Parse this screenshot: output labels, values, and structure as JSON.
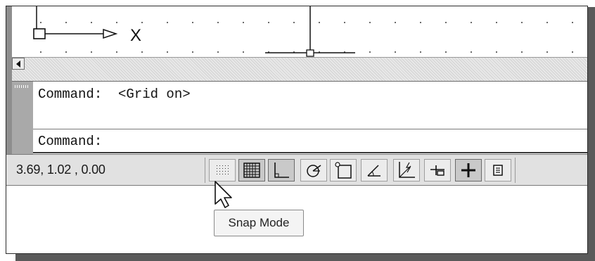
{
  "canvas": {
    "axis_label": "X"
  },
  "command_window": {
    "history_line": "Command:  <Grid on>",
    "prompt_line": "Command:"
  },
  "status_bar": {
    "coordinates": "3.69, 1.02 , 0.00",
    "toggles": [
      {
        "name": "snap-mode",
        "icon": "snap-dots-icon",
        "state": "off"
      },
      {
        "name": "grid-display",
        "icon": "grid-icon",
        "state": "on"
      },
      {
        "name": "ortho-mode",
        "icon": "ortho-icon",
        "state": "on"
      },
      {
        "name": "polar-tracking",
        "icon": "polar-icon",
        "state": "off"
      },
      {
        "name": "object-snap",
        "icon": "osnap-icon",
        "state": "off"
      },
      {
        "name": "object-snap-tracking",
        "icon": "angle-icon",
        "state": "off"
      },
      {
        "name": "dynamic-ucs",
        "icon": "ducs-icon",
        "state": "off"
      },
      {
        "name": "dynamic-input",
        "icon": "dyn-icon",
        "state": "off"
      },
      {
        "name": "lineweight",
        "icon": "lineweight-icon",
        "state": "on"
      },
      {
        "name": "quick-properties",
        "icon": "qp-icon",
        "state": "off"
      }
    ]
  },
  "tooltip": {
    "text": "Snap Mode"
  },
  "colors": {
    "toggle_on": "#c9c9c9",
    "toggle_off": "#ececec",
    "frame_shadow": "#5a5a5a"
  }
}
